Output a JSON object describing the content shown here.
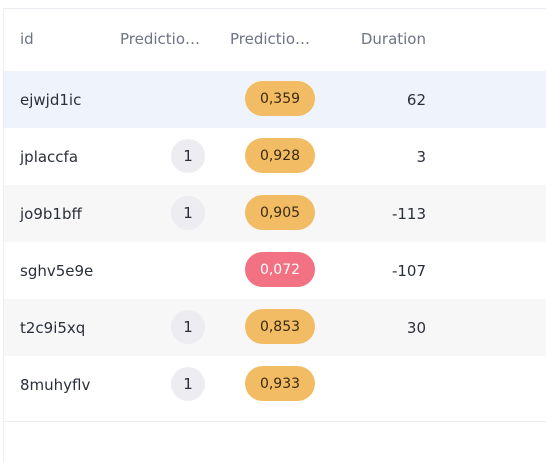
{
  "table": {
    "columns": {
      "id": "id",
      "prediction_count": "Predictio…",
      "prediction_score": "Predictio…",
      "duration": "Duration"
    },
    "rows": [
      {
        "id": "ejwjd1ic",
        "count": "",
        "score": "0,359",
        "score_level": "high",
        "duration": "62",
        "selected": true
      },
      {
        "id": "jplaccfa",
        "count": "1",
        "score": "0,928",
        "score_level": "high",
        "duration": "3",
        "selected": false
      },
      {
        "id": "jo9b1bff",
        "count": "1",
        "score": "0,905",
        "score_level": "high",
        "duration": "-113",
        "selected": false
      },
      {
        "id": "sghv5e9e",
        "count": "",
        "score": "0,072",
        "score_level": "low",
        "duration": "-107",
        "selected": false
      },
      {
        "id": "t2c9i5xq",
        "count": "1",
        "score": "0,853",
        "score_level": "high",
        "duration": "30",
        "selected": false
      },
      {
        "id": "8muhyflv",
        "count": "1",
        "score": "0,933",
        "score_level": "high",
        "duration": "",
        "selected": false
      }
    ]
  },
  "colors": {
    "score_high": "#f2bc64",
    "score_low": "#f27182",
    "selected_row": "#eff3fb",
    "alt_row": "#f7f7f8"
  }
}
